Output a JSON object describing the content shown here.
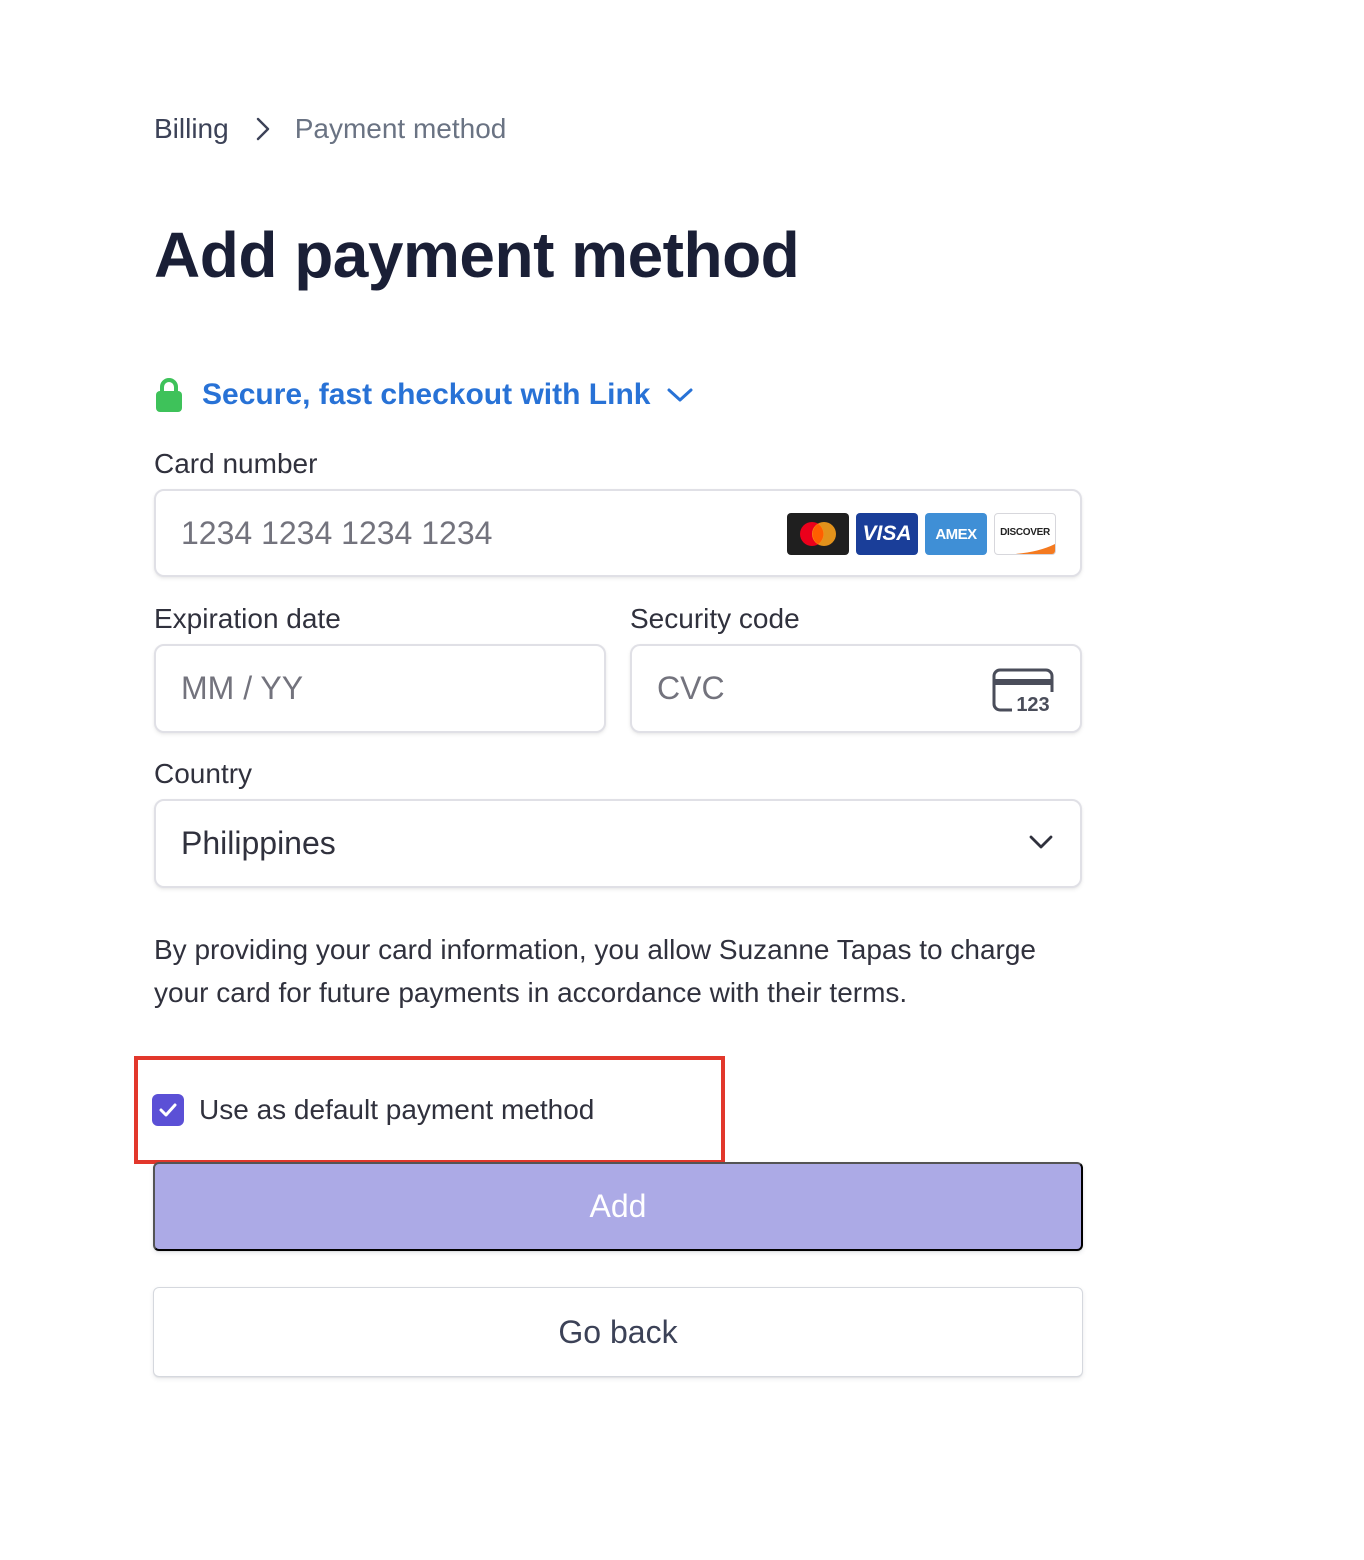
{
  "breadcrumb": {
    "parent": "Billing",
    "current": "Payment method"
  },
  "page_title": "Add payment method",
  "link": {
    "label": "Secure, fast checkout with Link",
    "accent_color": "#2872d6",
    "lock_color": "#3ec25a"
  },
  "card_number": {
    "label": "Card number",
    "placeholder": "1234 1234 1234 1234",
    "value": "",
    "brands": [
      {
        "name": "mastercard-icon",
        "text": ""
      },
      {
        "name": "visa-icon",
        "text": "VISA"
      },
      {
        "name": "amex-icon",
        "text": "AMEX"
      },
      {
        "name": "discover-icon",
        "text": "DISCOVER"
      }
    ]
  },
  "expiration": {
    "label": "Expiration date",
    "placeholder": "MM / YY",
    "value": ""
  },
  "security_code": {
    "label": "Security code",
    "placeholder": "CVC",
    "value": "",
    "icon_text": "123"
  },
  "country": {
    "label": "Country",
    "value": "Philippines"
  },
  "consent_text": "By providing your card information, you allow Suzanne Tapas to charge your card for future payments in accordance with their terms.",
  "default_checkbox": {
    "label": "Use as default payment method",
    "checked": true,
    "color": "#5b50d6"
  },
  "buttons": {
    "add": "Add",
    "back": "Go back"
  },
  "highlight_color": "#e2372b"
}
